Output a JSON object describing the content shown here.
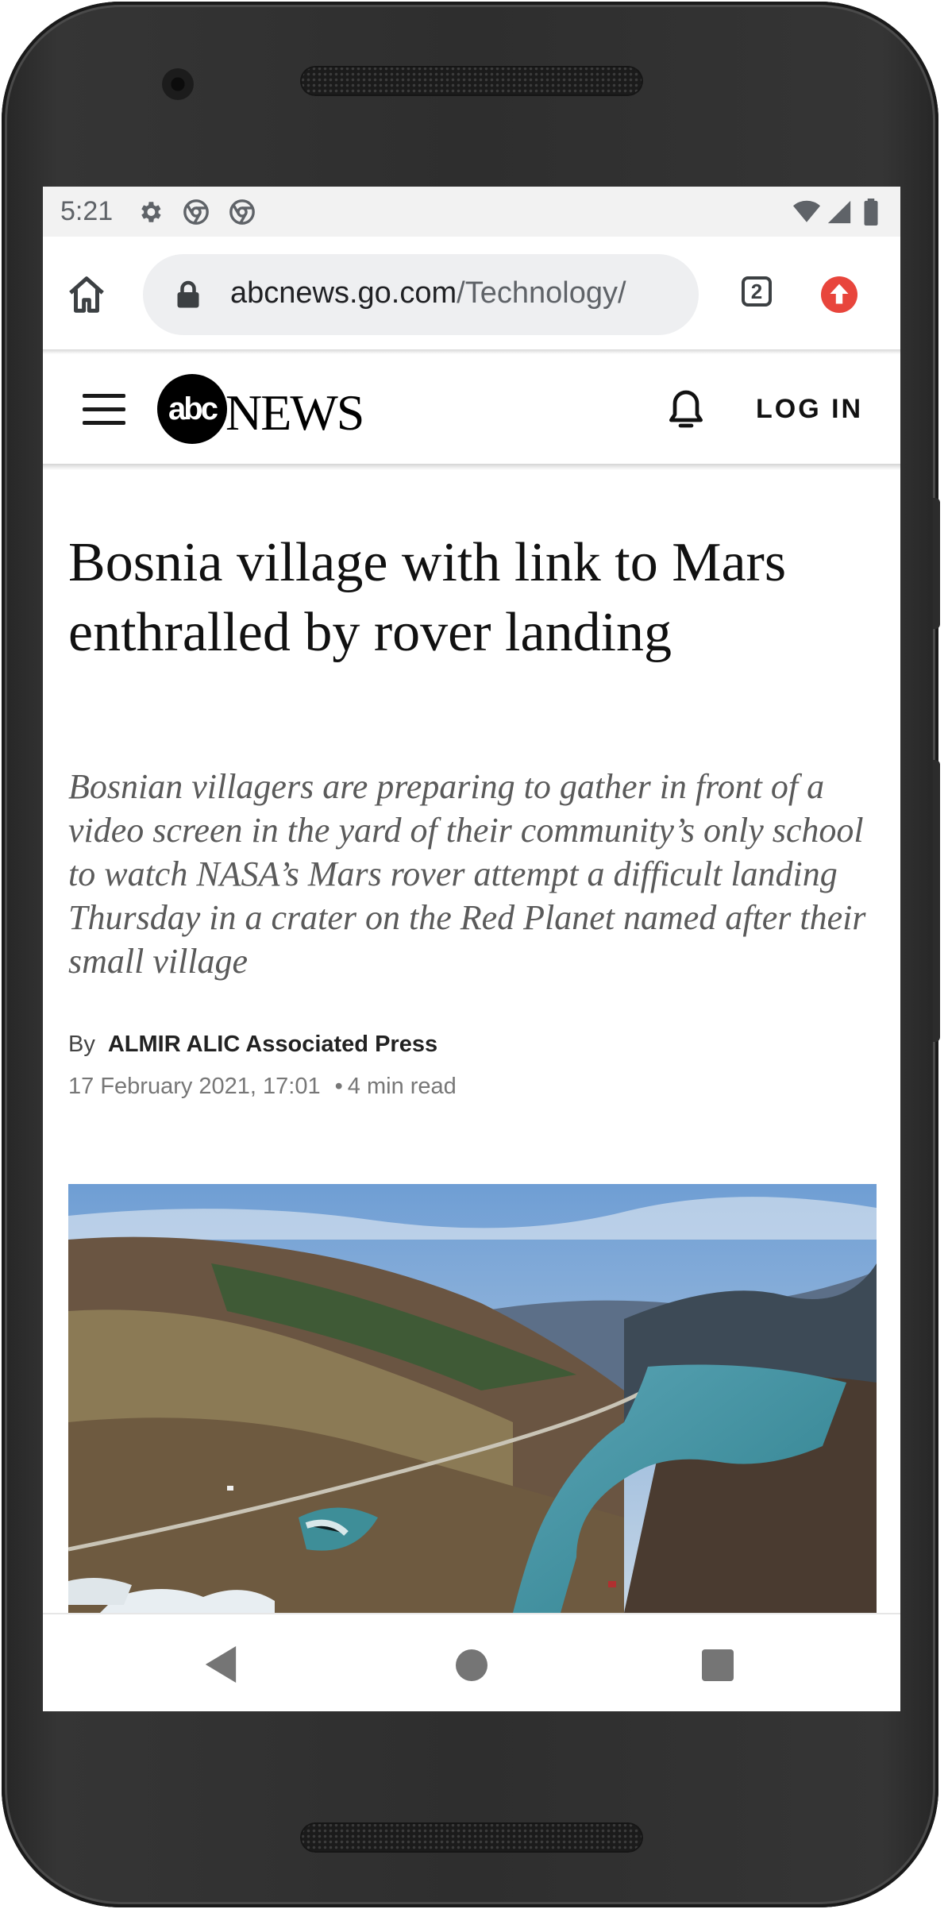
{
  "status_bar": {
    "time": "5:21",
    "left_icons": [
      "gear-icon",
      "chrome-icon",
      "chrome-icon"
    ],
    "right_icons": [
      "wifi-icon",
      "signal-icon",
      "battery-icon"
    ]
  },
  "browser": {
    "url_domain": "abcnews.go.com",
    "url_path": "/Technology/",
    "tab_count": "2",
    "accent_update": "#e8453c"
  },
  "site_header": {
    "logo_disc_text": "abc",
    "logo_news_text": "NEWS",
    "login_label": "LOG IN"
  },
  "article": {
    "headline": "Bosnia village with link to Mars enthralled by rover landing",
    "subheadline": "Bosnian villagers are preparing to gather in front of a video screen in the yard of their community’s only school to watch NASA’s Mars rover attempt a difficult landing Thursday in a crater on the Red Planet named after their small village",
    "byline_prefix": "By",
    "author": "ALMIR ALIC Associated Press",
    "date": "17 February 2021, 17:01",
    "separator": "•",
    "read_time": "4 min read"
  }
}
